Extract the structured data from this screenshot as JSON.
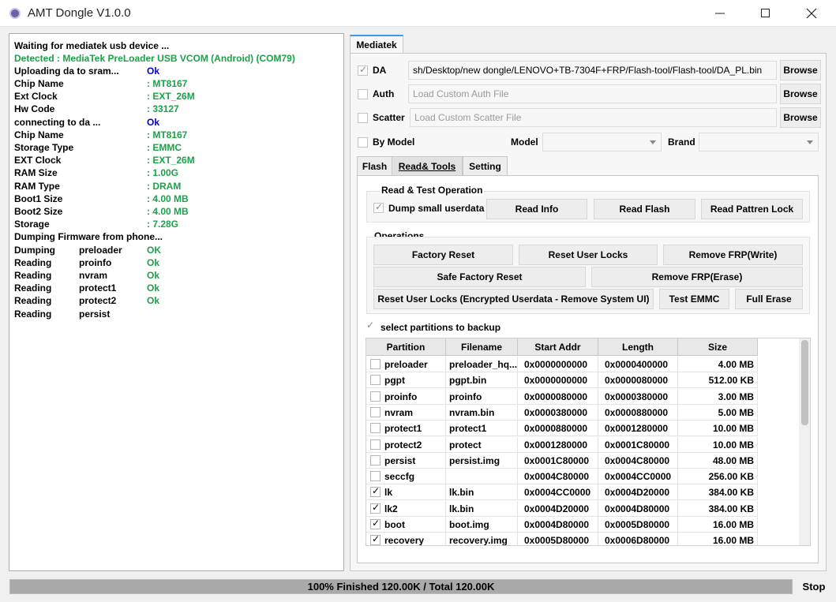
{
  "window": {
    "title": "AMT Dongle V1.0.0",
    "icon": "app-icon"
  },
  "log": [
    {
      "label": "Waiting for mediatek usb device ...",
      "value": "",
      "color": ""
    },
    {
      "label": "Detected  :  MediaTek PreLoader USB VCOM (Android) (COM79)",
      "value": "",
      "color": "#1ea04a"
    },
    {
      "label": "Uploading da to sram...",
      "value": "Ok",
      "color": "#0000dd"
    },
    {
      "label": "Chip Name",
      "value": ": MT8167",
      "color": "#1ea04a"
    },
    {
      "label": "Ext Clock",
      "value": ": EXT_26M",
      "color": "#1ea04a"
    },
    {
      "label": "Hw Code",
      "value": ": 33127",
      "color": "#1ea04a"
    },
    {
      "label": "connecting to da ...",
      "value": "Ok",
      "color": "#0000dd"
    },
    {
      "label": "Chip Name",
      "value": ": MT8167",
      "color": "#1ea04a"
    },
    {
      "label": "Storage Type",
      "value": ": EMMC",
      "color": "#1ea04a"
    },
    {
      "label": "EXT Clock",
      "value": ": EXT_26M",
      "color": "#1ea04a"
    },
    {
      "label": "RAM Size",
      "value": ": 1.00G",
      "color": "#1ea04a"
    },
    {
      "label": "RAM Type",
      "value": ": DRAM",
      "color": "#1ea04a"
    },
    {
      "label": "Boot1 Size",
      "value": ": 4.00 MB",
      "color": "#1ea04a"
    },
    {
      "label": "Boot2 Size",
      "value": ": 4.00 MB",
      "color": "#1ea04a"
    },
    {
      "label": "Storage",
      "value": ": 7.28G",
      "color": "#1ea04a"
    },
    {
      "label": "Dumping Firmware from phone...",
      "value": "",
      "color": ""
    }
  ],
  "dump_log": [
    {
      "action": "Dumping",
      "part": "preloader",
      "status": "OK"
    },
    {
      "action": "Reading",
      "part": "proinfo",
      "status": "Ok"
    },
    {
      "action": "Reading",
      "part": "nvram",
      "status": "Ok"
    },
    {
      "action": "Reading",
      "part": "protect1",
      "status": "Ok"
    },
    {
      "action": "Reading",
      "part": "protect2",
      "status": "Ok"
    },
    {
      "action": "Reading",
      "part": "persist",
      "status": ""
    }
  ],
  "main_tab": "Mediatek",
  "files": {
    "da_label": "DA",
    "da_path": "sh/Desktop/new dongle/LENOVO+TB-7304F+FRP/Flash-tool/Flash-tool/DA_PL.bin",
    "auth_label": "Auth",
    "auth_placeholder": "Load Custom Auth File",
    "scatter_label": "Scatter",
    "scatter_placeholder": "Load Custom Scatter File",
    "browse": "Browse"
  },
  "model_row": {
    "by_model": "By Model",
    "model": "Model",
    "brand": "Brand"
  },
  "subtabs": [
    "Flash",
    "Read& Tools",
    "Setting"
  ],
  "read_test": {
    "title": "Read & Test Operation",
    "dump_small": "Dump small userdata",
    "read_info": "Read Info",
    "read_flash": "Read Flash",
    "read_pattern": "Read Pattren Lock"
  },
  "operations": {
    "title": "Operations",
    "factory_reset": "Factory Reset",
    "reset_user_locks": "Reset User Locks",
    "remove_frp_write": "Remove FRP(Write)",
    "safe_factory_reset": "Safe Factory Reset",
    "remove_frp_erase": "Remove FRP(Erase)",
    "reset_encrypted": "Reset User Locks (Encrypted Userdata - Remove System UI)",
    "test_emmc": "Test EMMC",
    "full_erase": "Full Erase"
  },
  "backup_label": "select partitions to backup",
  "table": {
    "headers": [
      "Partition",
      "Filename",
      "Start Addr",
      "Length",
      "Size"
    ],
    "rows": [
      {
        "checked": false,
        "partition": "preloader",
        "filename": "preloader_hq...",
        "start": "0x0000000000",
        "length": "0x0000400000",
        "size": "4.00 MB"
      },
      {
        "checked": false,
        "partition": "pgpt",
        "filename": "pgpt.bin",
        "start": "0x0000000000",
        "length": "0x0000080000",
        "size": "512.00 KB"
      },
      {
        "checked": false,
        "partition": "proinfo",
        "filename": "proinfo",
        "start": "0x0000080000",
        "length": "0x0000380000",
        "size": "3.00 MB"
      },
      {
        "checked": false,
        "partition": "nvram",
        "filename": "nvram.bin",
        "start": "0x0000380000",
        "length": "0x0000880000",
        "size": "5.00 MB"
      },
      {
        "checked": false,
        "partition": "protect1",
        "filename": "protect1",
        "start": "0x0000880000",
        "length": "0x0001280000",
        "size": "10.00 MB"
      },
      {
        "checked": false,
        "partition": "protect2",
        "filename": "protect",
        "start": "0x0001280000",
        "length": "0x0001C80000",
        "size": "10.00 MB"
      },
      {
        "checked": false,
        "partition": "persist",
        "filename": "persist.img",
        "start": "0x0001C80000",
        "length": "0x0004C80000",
        "size": "48.00 MB"
      },
      {
        "checked": false,
        "partition": "seccfg",
        "filename": "",
        "start": "0x0004C80000",
        "length": "0x0004CC0000",
        "size": "256.00 KB"
      },
      {
        "checked": true,
        "partition": "lk",
        "filename": "lk.bin",
        "start": "0x0004CC0000",
        "length": "0x0004D20000",
        "size": "384.00 KB"
      },
      {
        "checked": true,
        "partition": "lk2",
        "filename": "lk.bin",
        "start": "0x0004D20000",
        "length": "0x0004D80000",
        "size": "384.00 KB"
      },
      {
        "checked": true,
        "partition": "boot",
        "filename": "boot.img",
        "start": "0x0004D80000",
        "length": "0x0005D80000",
        "size": "16.00 MB"
      },
      {
        "checked": true,
        "partition": "recovery",
        "filename": "recovery.img",
        "start": "0x0005D80000",
        "length": "0x0006D80000",
        "size": "16.00 MB"
      }
    ]
  },
  "progress": {
    "text": "100% Finished 120.00K / Total 120.00K",
    "percent": 100
  },
  "stop_label": "Stop"
}
